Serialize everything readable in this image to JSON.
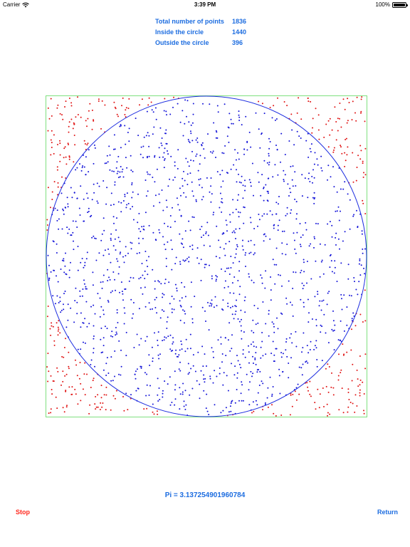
{
  "status_bar": {
    "carrier": "Carrier",
    "wifi_icon": "wifi-icon",
    "time": "3:39 PM",
    "battery_percent": "100%",
    "battery_icon": "battery-icon",
    "battery_level": 1.0
  },
  "stats": [
    {
      "label": "Total number of points",
      "value": "1836"
    },
    {
      "label": "Inside the circle",
      "value": "1440"
    },
    {
      "label": "Outside the circle",
      "value": "396"
    }
  ],
  "simulation": {
    "total_points": 1836,
    "inside_points": 1440,
    "outside_points": 396,
    "square_color": "#7fe07f",
    "circle_color": "#1f2fe0",
    "inside_point_color": "#1414d8",
    "outside_point_color": "#e01414"
  },
  "result": {
    "pi_text": "Pi = 3.137254901960784"
  },
  "actions": {
    "stop_label": "Stop",
    "return_label": "Return"
  },
  "colors": {
    "accent": "#1d6de0",
    "stop": "#ff2a1f"
  }
}
